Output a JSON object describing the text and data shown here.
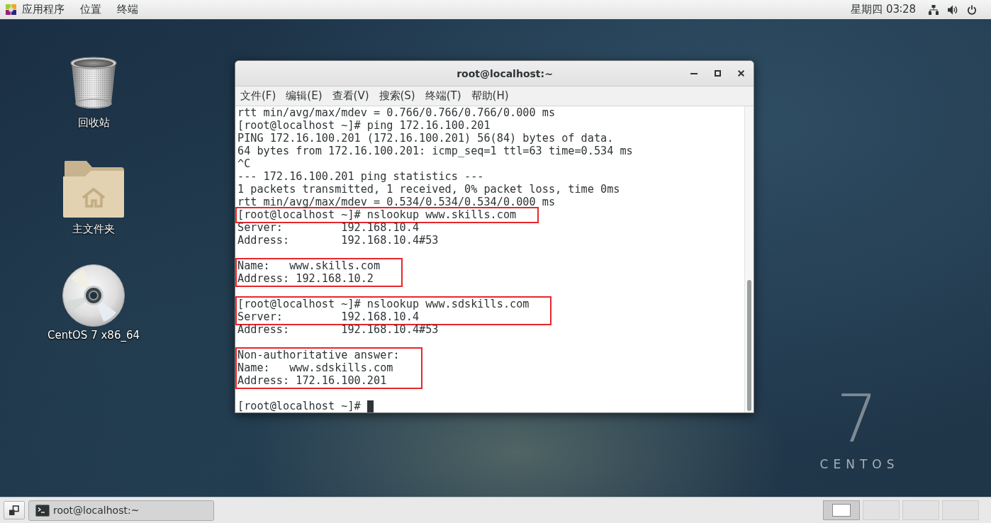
{
  "top_bar": {
    "menus": [
      "应用程序",
      "位置",
      "终端"
    ],
    "clock": "星期四 03∶28"
  },
  "desktop_icons": [
    {
      "kind": "trash",
      "label": "回收站"
    },
    {
      "kind": "home_folder",
      "label": "主文件夹"
    },
    {
      "kind": "disc",
      "label": "CentOS 7 x86_64"
    }
  ],
  "terminal_window": {
    "title": "root@localhost:~",
    "menu": [
      "文件(F)",
      "编辑(E)",
      "查看(V)",
      "搜索(S)",
      "终端(T)",
      "帮助(H)"
    ],
    "blocks": [
      {
        "highlighted": false,
        "lines": [
          {
            "kind": "text",
            "text": "rtt min/avg/max/mdev = 0.766/0.766/0.766/0.000 ms"
          },
          {
            "kind": "text",
            "text": "[root@localhost ~]# ping 172.16.100.201"
          },
          {
            "kind": "text",
            "text": "PING 172.16.100.201 (172.16.100.201) 56(84) bytes of data."
          },
          {
            "kind": "text",
            "text": "64 bytes from 172.16.100.201: icmp_seq=1 ttl=63 time=0.534 ms"
          },
          {
            "kind": "text",
            "text": "^C"
          },
          {
            "kind": "text",
            "text": "--- 172.16.100.201 ping statistics ---"
          },
          {
            "kind": "text",
            "text": "1 packets transmitted, 1 received, 0% packet loss, time 0ms"
          },
          {
            "kind": "text",
            "text": "rtt min/avg/max/mdev = 0.534/0.534/0.534/0.000 ms"
          }
        ]
      },
      {
        "highlighted": true,
        "lines": [
          {
            "kind": "text",
            "text": "[root@localhost ~]# nslookup www.skills.com"
          }
        ]
      },
      {
        "highlighted": false,
        "lines": [
          {
            "kind": "text",
            "text": "Server:         192.168.10.4"
          },
          {
            "kind": "text",
            "text": "Address:        192.168.10.4#53"
          },
          {
            "kind": "blank"
          }
        ]
      },
      {
        "highlighted": true,
        "lines": [
          {
            "kind": "text",
            "text": "Name:   www.skills.com"
          },
          {
            "kind": "text",
            "text": "Address: 192.168.10.2"
          }
        ]
      },
      {
        "highlighted": false,
        "lines": [
          {
            "kind": "blank"
          }
        ]
      },
      {
        "highlighted": true,
        "lines": [
          {
            "kind": "text",
            "text": "[root@localhost ~]# nslookup www.sdskills.com"
          },
          {
            "kind": "text",
            "text": "Server:         192.168.10.4"
          }
        ]
      },
      {
        "highlighted": false,
        "lines": [
          {
            "kind": "text",
            "text": "Address:        192.168.10.4#53"
          },
          {
            "kind": "blank"
          }
        ]
      },
      {
        "highlighted": true,
        "lines": [
          {
            "kind": "text",
            "text": "Non-authoritative answer:"
          },
          {
            "kind": "text",
            "text": "Name:   www.sdskills.com"
          },
          {
            "kind": "text",
            "text": "Address: 172.16.100.201"
          }
        ]
      },
      {
        "highlighted": false,
        "lines": [
          {
            "kind": "blank"
          },
          {
            "kind": "text",
            "text": "[root@localhost ~]#"
          }
        ]
      }
    ],
    "cursor": true
  },
  "wallpaper_logo": {
    "numeral": "7",
    "wordmark": "CENTOS"
  },
  "taskbar": {
    "tasks": [
      {
        "label": "root@localhost:~"
      }
    ],
    "workspaces": [
      {
        "selected": true
      },
      {
        "selected": false
      },
      {
        "selected": false
      },
      {
        "selected": false
      }
    ]
  }
}
